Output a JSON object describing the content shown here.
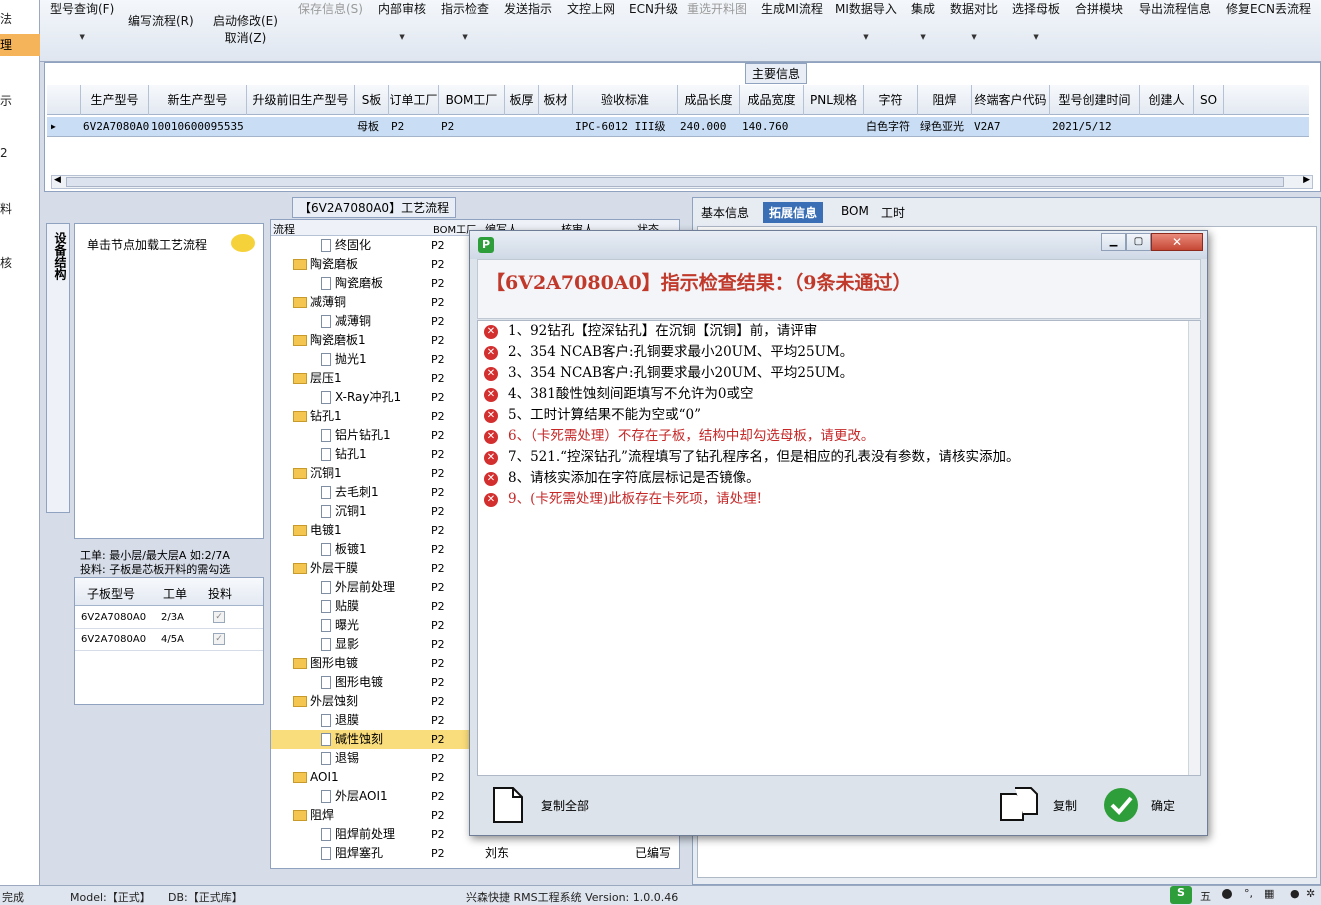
{
  "left_strip": {
    "items": [
      "法",
      "理",
      "示",
      "2",
      "料",
      "核"
    ]
  },
  "toolbar": {
    "items": [
      {
        "label": "型号查询(F)",
        "disabled": false,
        "dropdown": true
      },
      {
        "label": "编写流程(R)",
        "disabled": false,
        "dropdown": false
      },
      {
        "label": "启动修改(E)",
        "sub": "取消(Z)",
        "disabled": false,
        "dropdown": false
      },
      {
        "label": "保存信息(S)",
        "disabled": true,
        "dropdown": false
      },
      {
        "label": "内部审核",
        "disabled": false,
        "dropdown": true
      },
      {
        "label": "指示检查",
        "disabled": false,
        "dropdown": true
      },
      {
        "label": "发送指示",
        "disabled": false,
        "dropdown": false
      },
      {
        "label": "文控上网",
        "disabled": false,
        "dropdown": false
      },
      {
        "label": "ECN升级",
        "disabled": false,
        "dropdown": false
      },
      {
        "label": "重选开料图",
        "disabled": true,
        "dropdown": false
      },
      {
        "label": "生成MI流程",
        "disabled": false,
        "dropdown": false
      },
      {
        "label": "MI数据导入",
        "disabled": false,
        "dropdown": true
      },
      {
        "label": "集成",
        "disabled": false,
        "dropdown": true
      },
      {
        "label": "数据对比",
        "disabled": false,
        "dropdown": true
      },
      {
        "label": "选择母板",
        "disabled": false,
        "dropdown": true
      },
      {
        "label": "合拼模块",
        "disabled": false,
        "dropdown": false
      },
      {
        "label": "导出流程信息",
        "disabled": false,
        "dropdown": false
      },
      {
        "label": "修复ECN丢流程",
        "disabled": false,
        "dropdown": false
      }
    ]
  },
  "main_info": {
    "title": "主要信息",
    "columns": [
      "生产型号",
      "新生产型号",
      "升级前旧生产型号",
      "S板",
      "订单工厂",
      "BOM工厂",
      "板厚",
      "板材",
      "验收标准",
      "成品长度",
      "成品宽度",
      "PNL规格",
      "字符",
      "阻焊",
      "终端客户代码",
      "型号创建时间",
      "创建人",
      "SO"
    ],
    "row": [
      "6V2A7080A0",
      "10010600095535",
      "",
      "母板",
      "P2",
      "P2",
      "",
      "",
      "IPC-6012 III级",
      "240.000",
      "140.760",
      "",
      "白色字符",
      "绿色亚光",
      "V2A7",
      "2021/5/12",
      "",
      ""
    ]
  },
  "left_panel": {
    "vtab_label": "设备结构",
    "load_hint": "单击节点加载工艺流程",
    "note_line1": "工单: 最小层/最大层A 如:2/7A",
    "note_line2": "投料: 子板是芯板开料的需勾选",
    "sub_columns": [
      "子板型号",
      "工单",
      "投料"
    ],
    "sub_rows": [
      {
        "model": "6V2A7080A0",
        "order": "2/3A",
        "checked": true
      },
      {
        "model": "6V2A7080A0",
        "order": "4/5A",
        "checked": true
      }
    ]
  },
  "process": {
    "title": "【6V2A7080A0】工艺流程",
    "columns": [
      "流程",
      "BOM工厂",
      "编写人",
      "核审人",
      "状态"
    ],
    "rows": [
      {
        "label": "终固化",
        "type": "doc",
        "bom": "P2"
      },
      {
        "label": "陶瓷磨板",
        "type": "folder",
        "bom": "P2"
      },
      {
        "label": "陶瓷磨板",
        "type": "doc",
        "bom": "P2"
      },
      {
        "label": "减薄铜",
        "type": "folder",
        "bom": "P2"
      },
      {
        "label": "减薄铜",
        "type": "doc",
        "bom": "P2"
      },
      {
        "label": "陶瓷磨板1",
        "type": "folder",
        "bom": "P2"
      },
      {
        "label": "抛光1",
        "type": "doc",
        "bom": "P2"
      },
      {
        "label": "层压1",
        "type": "folder",
        "bom": "P2"
      },
      {
        "label": "X-Ray冲孔1",
        "type": "doc",
        "bom": "P2"
      },
      {
        "label": "钻孔1",
        "type": "folder",
        "bom": "P2"
      },
      {
        "label": "铝片钻孔1",
        "type": "doc",
        "bom": "P2"
      },
      {
        "label": "钻孔1",
        "type": "doc",
        "bom": "P2"
      },
      {
        "label": "沉铜1",
        "type": "folder",
        "bom": "P2"
      },
      {
        "label": "去毛刺1",
        "type": "doc",
        "bom": "P2"
      },
      {
        "label": "沉铜1",
        "type": "doc",
        "bom": "P2"
      },
      {
        "label": "电镀1",
        "type": "folder",
        "bom": "P2"
      },
      {
        "label": "板镀1",
        "type": "doc",
        "bom": "P2"
      },
      {
        "label": "外层干膜",
        "type": "folder",
        "bom": "P2"
      },
      {
        "label": "外层前处理",
        "type": "doc",
        "bom": "P2"
      },
      {
        "label": "贴膜",
        "type": "doc",
        "bom": "P2"
      },
      {
        "label": "曝光",
        "type": "doc",
        "bom": "P2"
      },
      {
        "label": "显影",
        "type": "doc",
        "bom": "P2"
      },
      {
        "label": "图形电镀",
        "type": "folder",
        "bom": "P2"
      },
      {
        "label": "图形电镀",
        "type": "doc",
        "bom": "P2"
      },
      {
        "label": "外层蚀刻",
        "type": "folder",
        "bom": "P2"
      },
      {
        "label": "退膜",
        "type": "doc",
        "bom": "P2"
      },
      {
        "label": "碱性蚀刻",
        "type": "doc",
        "bom": "P2",
        "selected": true
      },
      {
        "label": "退锡",
        "type": "doc",
        "bom": "P2"
      },
      {
        "label": "AOI1",
        "type": "folder",
        "bom": "P2"
      },
      {
        "label": "外层AOI1",
        "type": "doc",
        "bom": "P2"
      },
      {
        "label": "阻焊",
        "type": "folder",
        "bom": "P2"
      },
      {
        "label": "阻焊前处理",
        "type": "doc",
        "bom": "P2"
      },
      {
        "label": "阻焊塞孔",
        "type": "doc",
        "bom": "P2",
        "writer": "刘东",
        "status": "已编写"
      }
    ]
  },
  "right_tabs": [
    "基本信息",
    "拓展信息",
    "BOM",
    "工时"
  ],
  "right_active_tab": "拓展信息",
  "dialog": {
    "title": "【6V2A7080A0】指示检查结果：（9条未通过）",
    "messages": [
      {
        "text": "1、92钻孔【控深钻孔】在沉铜【沉铜】前，请评审",
        "red": false
      },
      {
        "text": "2、354 NCAB客户:孔铜要求最小20UM、平均25UM。",
        "red": false
      },
      {
        "text": "3、354 NCAB客户:孔铜要求最小20UM、平均25UM。",
        "red": false
      },
      {
        "text": "4、381酸性蚀刻间距填写不允许为0或空",
        "red": false
      },
      {
        "text": "5、工时计算结果不能为空或“0”",
        "red": false
      },
      {
        "text": "6、（卡死需处理）不存在子板，结构中却勾选母板，请更改。",
        "red": true
      },
      {
        "text": "7、521.“控深钻孔”流程填写了钻孔程序名，但是相应的孔表没有参数，请核实添加。",
        "red": false
      },
      {
        "text": "8、请核实添加在字符底层标记是否镜像。",
        "red": false
      },
      {
        "text": "9、(卡死需处理)此板存在卡死项，请处理!",
        "red": true
      }
    ],
    "copy_all_label": "复制全部",
    "copy_label": "复制",
    "ok_label": "确定"
  },
  "statusbar": {
    "left": "完成",
    "model": "Model:【正式】",
    "db": "DB:【正式库】",
    "system": "兴森快捷 RMS工程系统 Version: 1.0.0.46",
    "tray_ime": "五"
  },
  "colors": {
    "accent": "#3a6fb6",
    "error": "#d32f2f",
    "ok_green": "#2e9e3a",
    "selected_row": "#c9ddf4",
    "tree_selected": "#f9dc7b"
  }
}
